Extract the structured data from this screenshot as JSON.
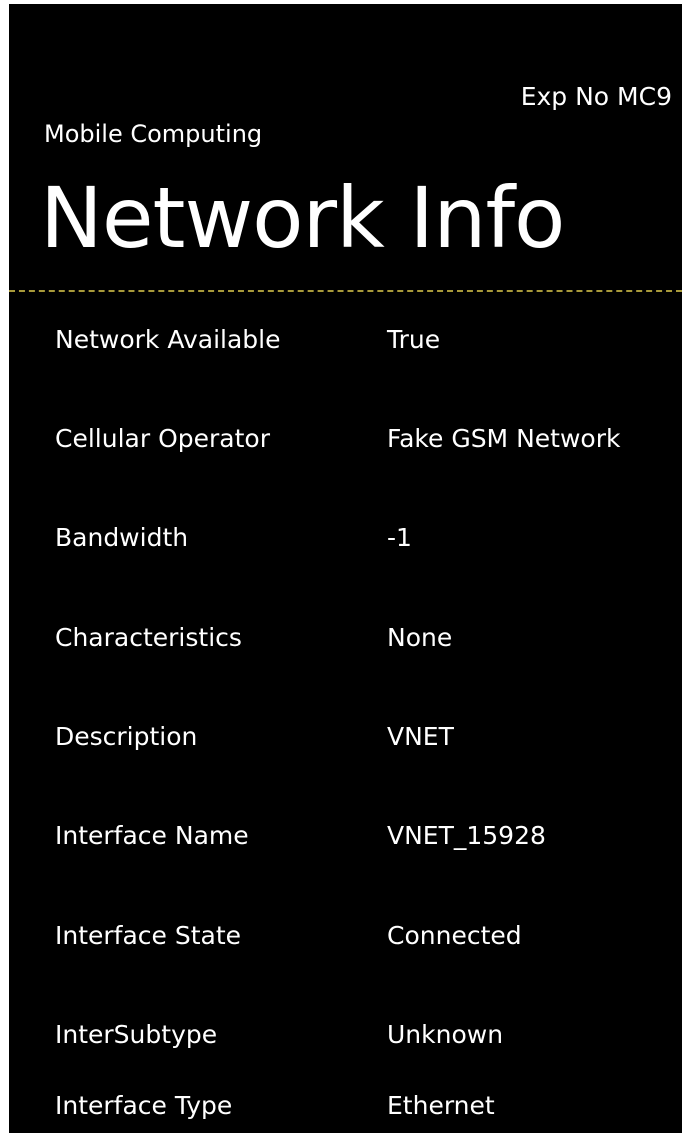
{
  "header": {
    "exp_label": "Exp No MC9",
    "app_title": "Mobile Computing",
    "page_title": "Network Info"
  },
  "rows": [
    {
      "label": "Network Available",
      "value": "True"
    },
    {
      "label": "Cellular Operator",
      "value": "Fake GSM Network"
    },
    {
      "label": "Bandwidth",
      "value": "-1"
    },
    {
      "label": "Characteristics",
      "value": "None"
    },
    {
      "label": "Description",
      "value": "VNET"
    },
    {
      "label": "Interface Name",
      "value": "VNET_15928"
    },
    {
      "label": "Interface State",
      "value": "Connected"
    },
    {
      "label": "InterSubtype",
      "value": "Unknown"
    },
    {
      "label": "Interface Type",
      "value": "Ethernet"
    }
  ],
  "colors": {
    "background": "#000000",
    "text": "#ffffff",
    "divider": "#a89a3a"
  }
}
